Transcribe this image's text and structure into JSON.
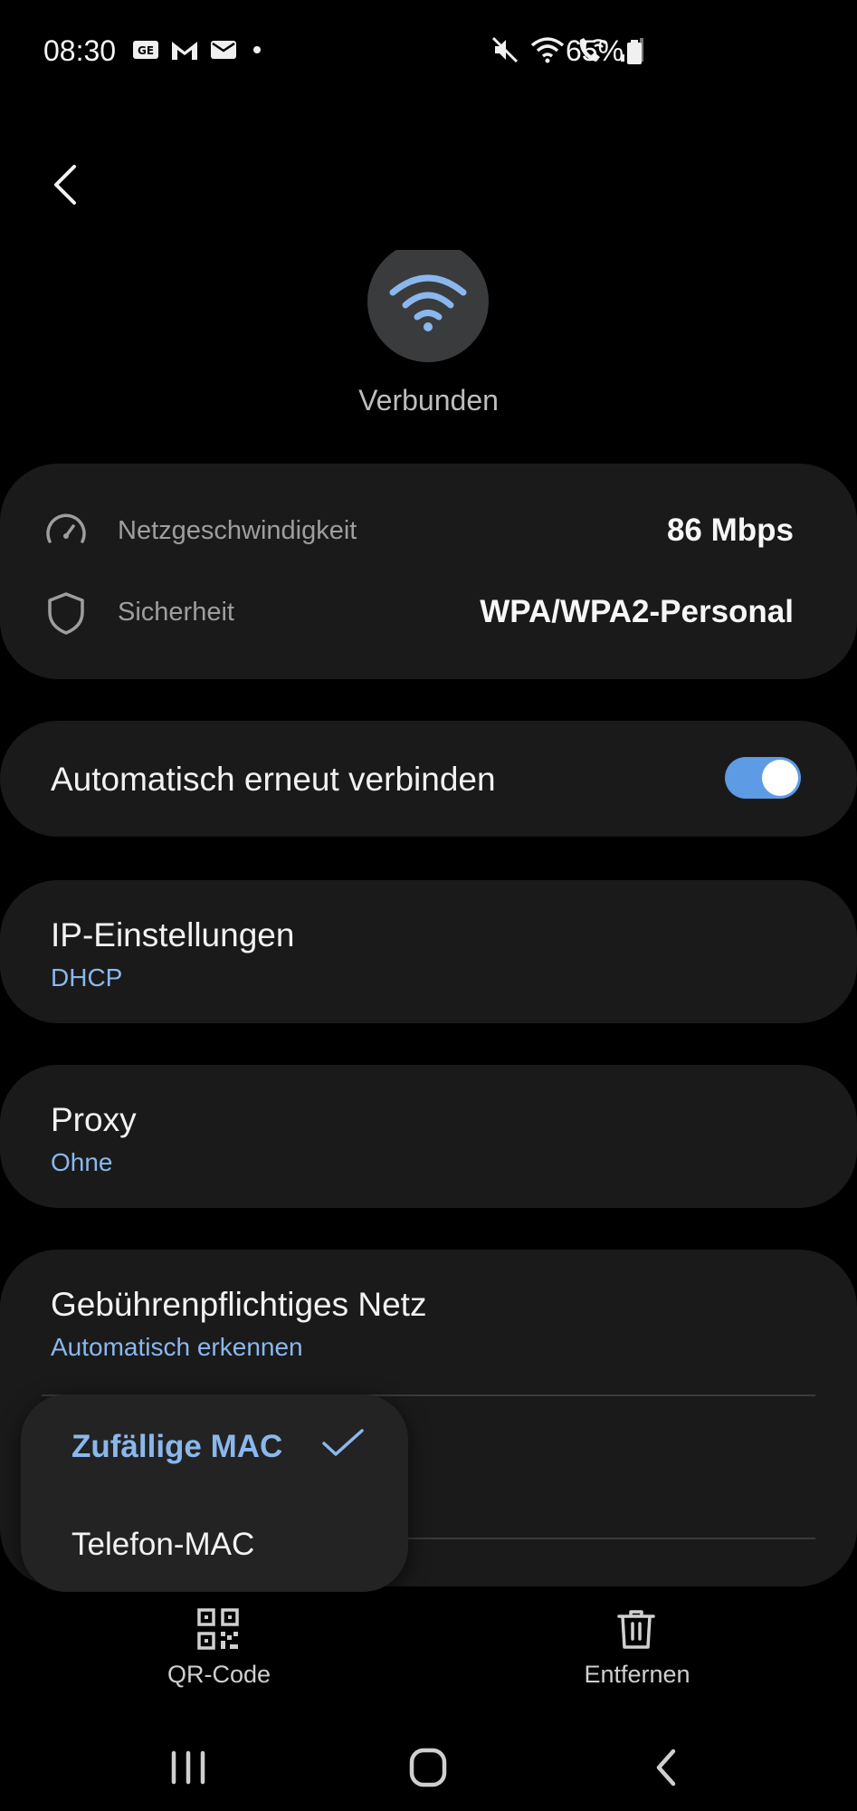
{
  "status_bar": {
    "time": "08:30",
    "battery": "65%",
    "left_icons": [
      "gmail-like-icon",
      "mail-m-icon",
      "email-icon",
      "dot-icon"
    ],
    "right_icons": [
      "mute-icon",
      "wifi-icon",
      "wifi-call-icon",
      "signal-icon",
      "battery-icon"
    ]
  },
  "header": {
    "status": "Verbunden",
    "icon": "wifi-icon"
  },
  "info": {
    "speed_label": "Netzgeschwindigkeit",
    "speed_value": "86 Mbps",
    "security_label": "Sicherheit",
    "security_value": "WPA/WPA2-Personal"
  },
  "auto_reconnect": {
    "label": "Automatisch erneut verbinden",
    "enabled": true
  },
  "ip_settings": {
    "title": "IP-Einstellungen",
    "value": "DHCP"
  },
  "proxy": {
    "title": "Proxy",
    "value": "Ohne"
  },
  "metered": {
    "title": "Gebührenpflichtiges Netz",
    "value": "Automatisch erkennen"
  },
  "mac_popup": {
    "options": [
      {
        "label": "Zufällige MAC",
        "selected": true
      },
      {
        "label": "Telefon-MAC",
        "selected": false
      }
    ]
  },
  "actions": {
    "qr_label": "QR-Code",
    "remove_label": "Entfernen"
  },
  "colors": {
    "accent": "#8ab8ee",
    "toggle": "#5d9be4",
    "card": "#1a1a1a",
    "background": "#000000"
  }
}
